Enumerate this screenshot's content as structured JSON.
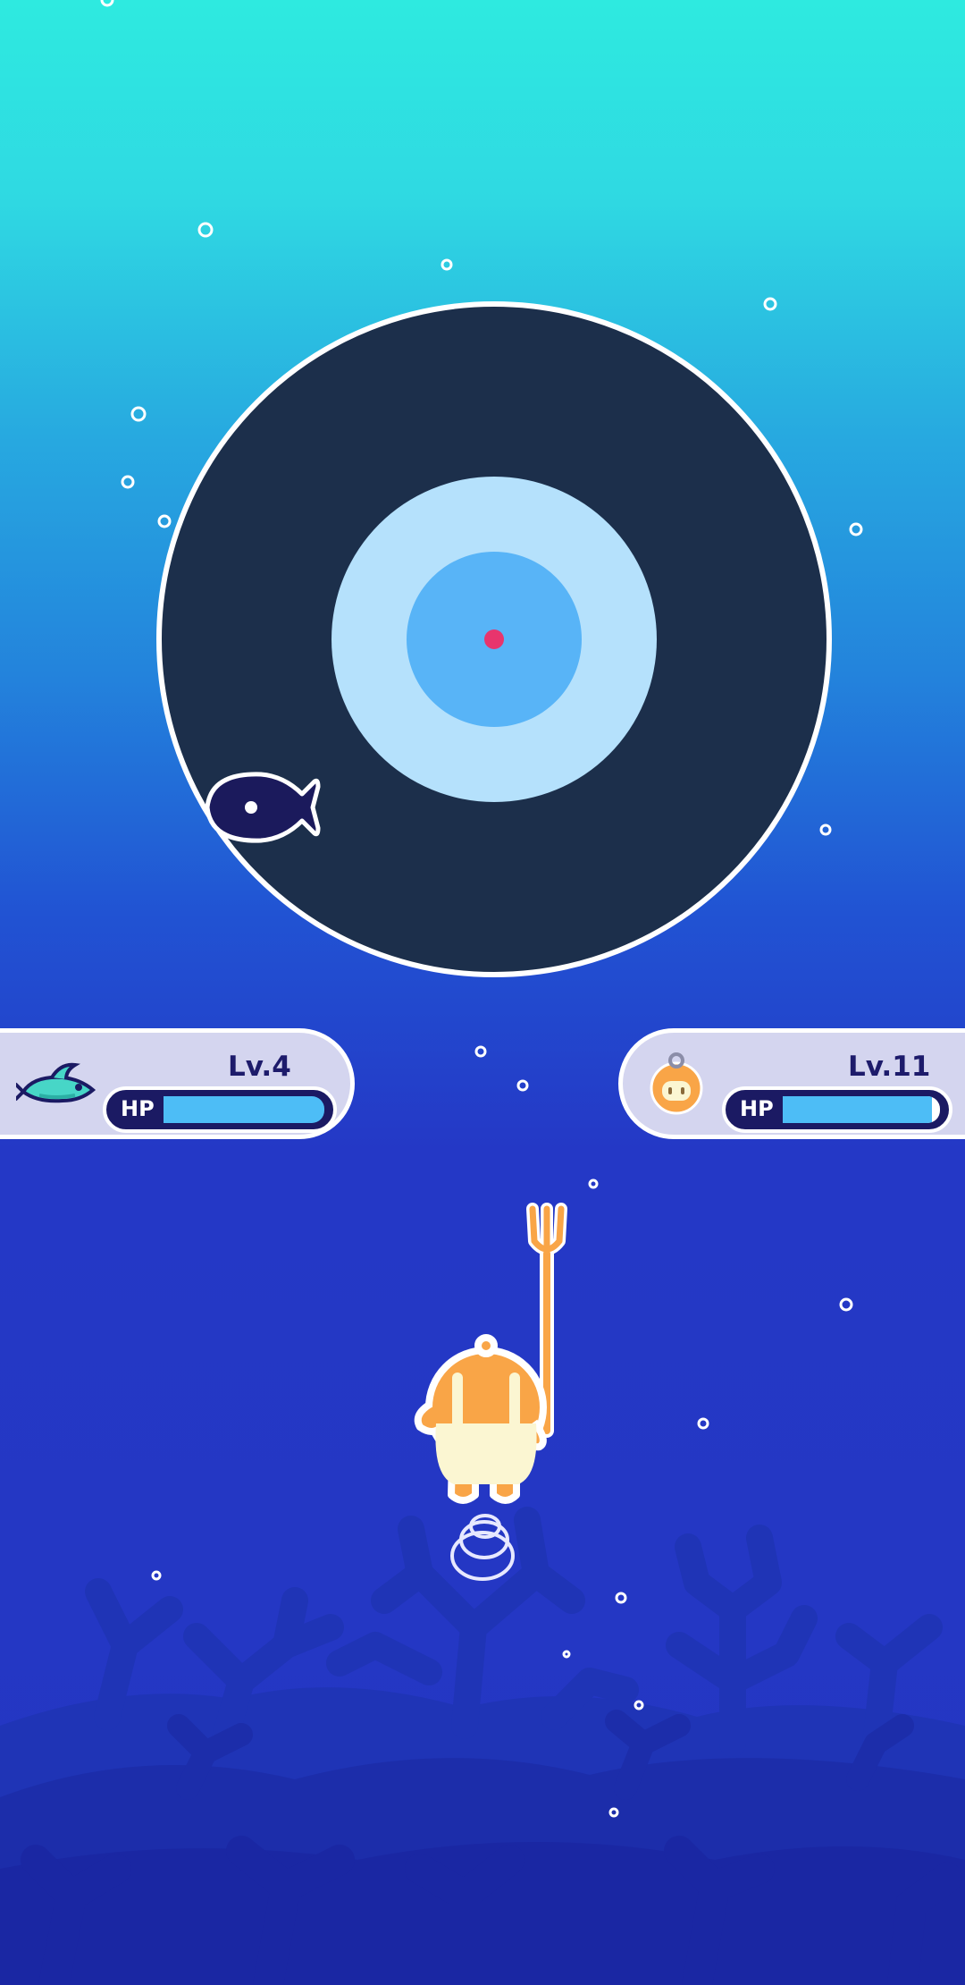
{
  "enemy": {
    "level": "Lv.4",
    "hp_label": "HP",
    "hp_fraction": 1.0,
    "icon": "fish-icon"
  },
  "player": {
    "level": "Lv.11",
    "hp_label": "HP",
    "hp_fraction": 0.95,
    "icon": "diver-avatar-icon"
  },
  "target": {
    "center_color": "#e8356d",
    "ring_colors": [
      "#1c2f4b",
      "#b5e1fc",
      "#58b4f7"
    ]
  },
  "colors": {
    "water_top": "#2eeae0",
    "water_bottom": "#2436c2",
    "coral": "#2030b0",
    "hud_text": "#1d1b6b"
  }
}
